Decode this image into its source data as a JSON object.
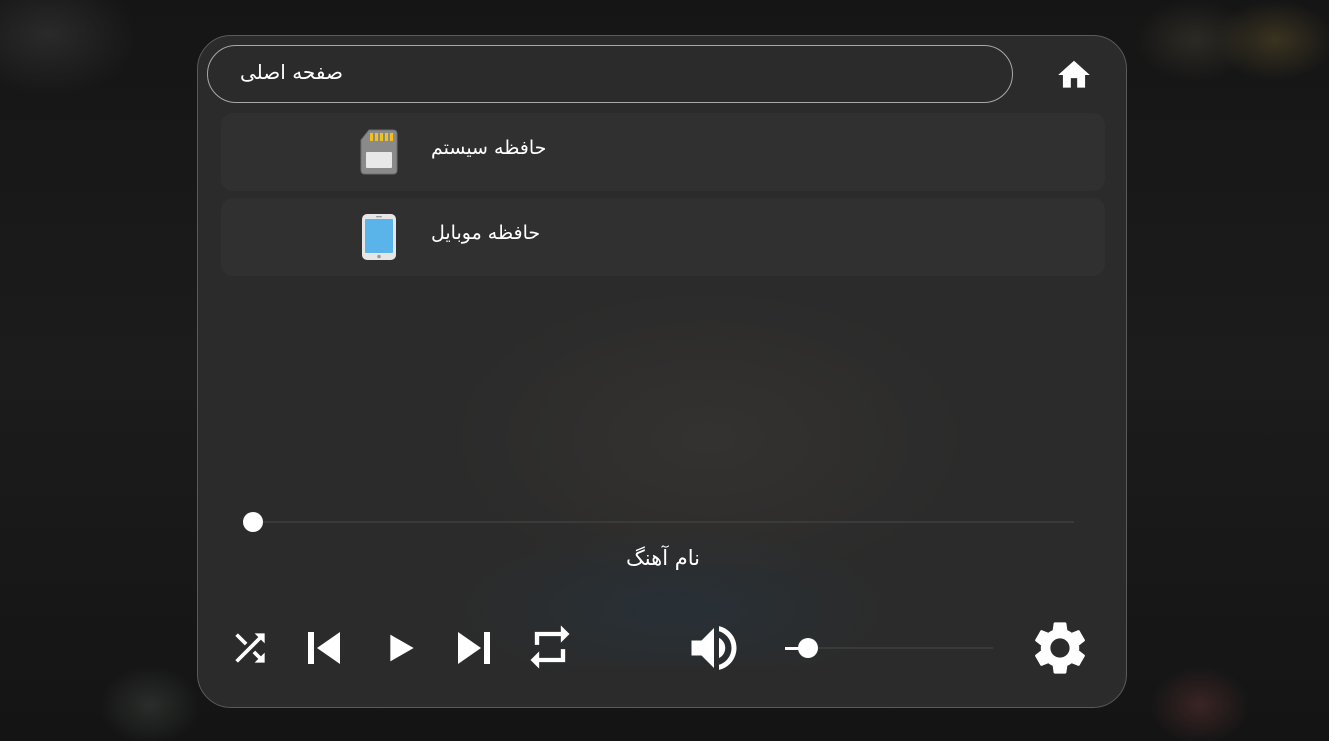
{
  "header": {
    "path_label": "صفحه اصلی"
  },
  "storage": {
    "items": [
      {
        "label": "حافظه سیستم",
        "icon": "sd-card-icon"
      },
      {
        "label": "حافظه موبایل",
        "icon": "mobile-phone-icon"
      }
    ]
  },
  "player": {
    "song_title": "نام آهنگ",
    "seek_progress": 0,
    "volume_level": 0.05,
    "controls": [
      "shuffle-icon",
      "previous-icon",
      "play-icon",
      "next-icon",
      "repeat-icon",
      "volume-icon",
      "settings-icon"
    ]
  },
  "colors": {
    "panel_background": "#2b2b2b",
    "panel_border": "#5a5a5a",
    "text": "#ffffff",
    "track": "#3a3a3a"
  }
}
